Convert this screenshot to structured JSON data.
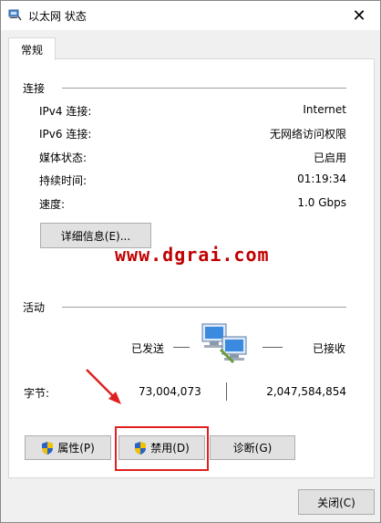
{
  "window": {
    "title": "以太网 状态",
    "close_glyph": "✕"
  },
  "tabs": [
    {
      "label": "常规"
    }
  ],
  "connection": {
    "heading": "连接",
    "rows": [
      {
        "label": "IPv4 连接:",
        "value": "Internet"
      },
      {
        "label": "IPv6 连接:",
        "value": "无网络访问权限"
      },
      {
        "label": "媒体状态:",
        "value": "已启用"
      },
      {
        "label": "持续时间:",
        "value": "01:19:34"
      },
      {
        "label": "速度:",
        "value": "1.0 Gbps"
      }
    ],
    "details_button": "详细信息(E)..."
  },
  "watermark": "www.dgrai.com",
  "activity": {
    "heading": "活动",
    "sent_label": "已发送",
    "received_label": "已接收",
    "bytes_label": "字节:",
    "bytes_sent": "73,004,073",
    "bytes_received": "2,047,584,854"
  },
  "buttons": {
    "properties": "属性(P)",
    "disable": "禁用(D)",
    "diagnose": "诊断(G)",
    "close": "关闭(C)"
  },
  "icons": {
    "title": "network-icon",
    "shield": "uac-shield-icon",
    "network_computers": "network-computers-icon",
    "arrow": "red-arrow-icon"
  },
  "colors": {
    "annotation_red": "#e02020",
    "watermark_red": "#c00000"
  }
}
